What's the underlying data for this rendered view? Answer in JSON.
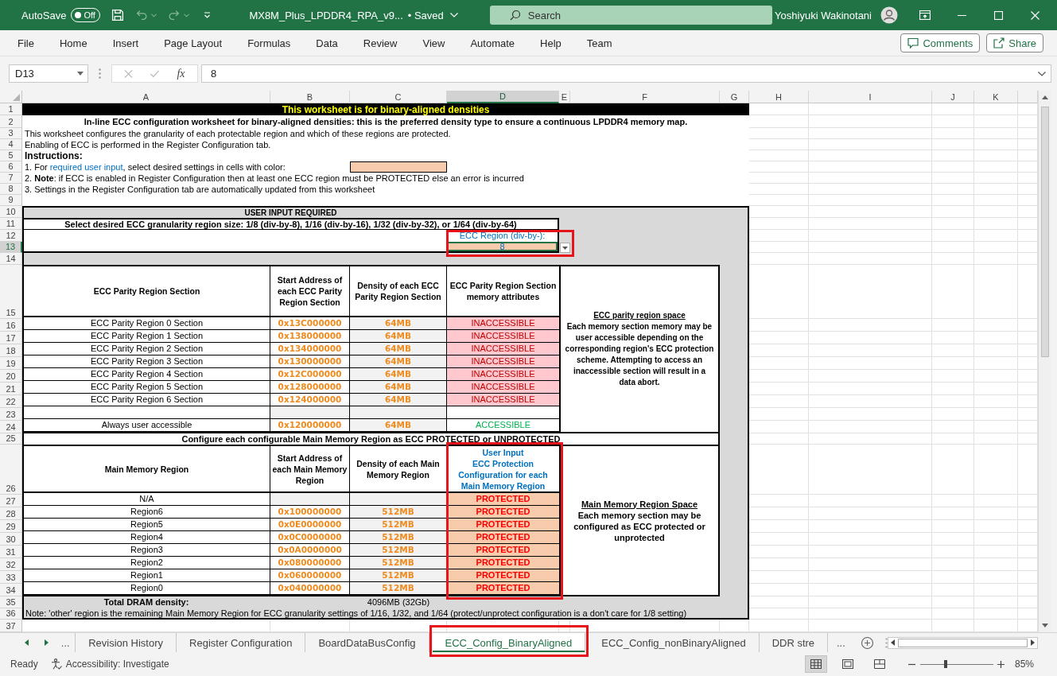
{
  "title_bar": {
    "autosave_label": "AutoSave",
    "autosave": {
      "on": false,
      "label": "Off"
    },
    "file_name": "MX8M_Plus_LPDDR4_RPA_v9...",
    "save_status": "• Saved",
    "search": {
      "placeholder": "Search"
    },
    "user_name": "Yoshiyuki Wakinotani"
  },
  "quick_access": [
    {
      "kind": "save",
      "disabled": false
    },
    {
      "kind": "undo",
      "disabled": true
    },
    {
      "kind": "redo",
      "disabled": true
    }
  ],
  "ribbon": {
    "tabs": [
      {
        "label": "File",
        "selected": false
      },
      {
        "label": "Home",
        "selected": false
      },
      {
        "label": "Insert",
        "selected": false
      },
      {
        "label": "Page Layout",
        "selected": false
      },
      {
        "label": "Formulas",
        "selected": false
      },
      {
        "label": "Data",
        "selected": false
      },
      {
        "label": "Review",
        "selected": false
      },
      {
        "label": "View",
        "selected": false
      },
      {
        "label": "Automate",
        "selected": false
      },
      {
        "label": "Help",
        "selected": false
      },
      {
        "label": "Team",
        "selected": false
      }
    ],
    "buttons": [
      {
        "kind": "comments",
        "label": "Comments"
      },
      {
        "kind": "share",
        "label": "Share"
      }
    ]
  },
  "formula_bar": {
    "name_box": "D13",
    "actions": [
      {
        "kind": "cancel",
        "disabled": true
      },
      {
        "kind": "enter",
        "disabled": true
      }
    ],
    "function_label": "fx",
    "value": "8"
  },
  "columns": [
    {
      "label": "A",
      "selected": false
    },
    {
      "label": "B",
      "selected": false
    },
    {
      "label": "C",
      "selected": false
    },
    {
      "label": "D",
      "selected": true
    },
    {
      "label": "E",
      "selected": false
    },
    {
      "label": "F",
      "selected": false
    },
    {
      "label": "G",
      "selected": false
    },
    {
      "label": "H",
      "selected": false
    },
    {
      "label": "I",
      "selected": false
    },
    {
      "label": "J",
      "selected": false
    },
    {
      "label": "K",
      "selected": false
    }
  ],
  "rows": [
    {
      "label": "1",
      "selected": false
    },
    {
      "label": "2",
      "selected": false
    },
    {
      "label": "3",
      "selected": false
    },
    {
      "label": "4",
      "selected": false
    },
    {
      "label": "5",
      "selected": false
    },
    {
      "label": "6",
      "selected": false
    },
    {
      "label": "7",
      "selected": false
    },
    {
      "label": "8",
      "selected": false
    },
    {
      "label": "9",
      "selected": false
    },
    {
      "label": "10",
      "selected": false
    },
    {
      "label": "11",
      "selected": false
    },
    {
      "label": "12",
      "selected": false
    },
    {
      "label": "13",
      "selected": true
    },
    {
      "label": "14",
      "selected": false
    },
    {
      "label": "15",
      "selected": false
    },
    {
      "label": "16",
      "selected": false
    },
    {
      "label": "17",
      "selected": false
    },
    {
      "label": "18",
      "selected": false
    },
    {
      "label": "19",
      "selected": false
    },
    {
      "label": "20",
      "selected": false
    },
    {
      "label": "21",
      "selected": false
    },
    {
      "label": "22",
      "selected": false
    },
    {
      "label": "23",
      "selected": false
    },
    {
      "label": "24",
      "selected": false
    },
    {
      "label": "25",
      "selected": false
    },
    {
      "label": "26",
      "selected": false
    },
    {
      "label": "27",
      "selected": false
    },
    {
      "label": "28",
      "selected": false
    },
    {
      "label": "29",
      "selected": false
    },
    {
      "label": "30",
      "selected": false
    },
    {
      "label": "31",
      "selected": false
    },
    {
      "label": "32",
      "selected": false
    },
    {
      "label": "33",
      "selected": false
    },
    {
      "label": "34",
      "selected": false
    },
    {
      "label": "35",
      "selected": false
    },
    {
      "label": "36",
      "selected": false
    },
    {
      "label": "37",
      "selected": false
    }
  ],
  "sheet": {
    "banner": "This worksheet is for binary-aligned densities",
    "heading": "In-line ECC configuration worksheet for binary-aligned densities: this is the preferred density type to ensure a continuous LPDDR4 memory map.",
    "intro": [
      "This worksheet configures the granularity of each protectable region and which of these regions are protected.",
      "Enabling of ECC is performed in the Register Configuration tab."
    ],
    "instructions_label": "Instructions:",
    "instructions": [
      {
        "parts": [
          {
            "kind": "plain",
            "text": "1. For "
          },
          {
            "kind": "input",
            "text": "required user input"
          },
          {
            "kind": "plain",
            "text": ", select desired settings in cells with color:"
          }
        ],
        "swatch": true
      },
      {
        "parts": [
          {
            "kind": "plain",
            "text": "2. **Note**: if ECC is enabled in Register Configuration then at least one ECC region must be PROTECTED else an error is incurred"
          }
        ],
        "swatch": false
      },
      {
        "parts": [
          {
            "kind": "plain",
            "text": "3. Settings in the Register Configuration tab are automatically updated from this worksheet"
          }
        ],
        "swatch": false
      }
    ],
    "user_input_title": "USER INPUT REQUIRED",
    "granularity_prompt": "Select desired ECC granularity region size: 1/8 (div-by-8), 1/16 (div-by-16), 1/32 (div-by-32), or 1/64 (div-by-64)",
    "ecc_region": {
      "label": "ECC Region (div-by-):",
      "value": "8",
      "selected": true,
      "highlighted": true
    },
    "parity_table": {
      "columns": [
        {
          "label": "ECC Parity Region Section",
          "user_input": false
        },
        {
          "label": "Start Address of each ECC Parity Region Section",
          "user_input": false
        },
        {
          "label": "Density of each ECC Parity Region Section",
          "user_input": false
        },
        {
          "label": "ECC Parity Region Section memory attributes",
          "user_input": false
        }
      ],
      "rows": [
        {
          "kind": "region",
          "name": "ECC Parity Region 0 Section",
          "address": "0x13C000000",
          "density": "64MB",
          "attribute": "INACCESSIBLE",
          "accessible": false
        },
        {
          "kind": "region",
          "name": "ECC Parity Region 1 Section",
          "address": "0x138000000",
          "density": "64MB",
          "attribute": "INACCESSIBLE",
          "accessible": false
        },
        {
          "kind": "region",
          "name": "ECC Parity Region 2 Section",
          "address": "0x134000000",
          "density": "64MB",
          "attribute": "INACCESSIBLE",
          "accessible": false
        },
        {
          "kind": "region",
          "name": "ECC Parity Region 3 Section",
          "address": "0x130000000",
          "density": "64MB",
          "attribute": "INACCESSIBLE",
          "accessible": false
        },
        {
          "kind": "region",
          "name": "ECC Parity Region 4 Section",
          "address": "0x12C000000",
          "density": "64MB",
          "attribute": "INACCESSIBLE",
          "accessible": false
        },
        {
          "kind": "region",
          "name": "ECC Parity Region 5 Section",
          "address": "0x128000000",
          "density": "64MB",
          "attribute": "INACCESSIBLE",
          "accessible": false
        },
        {
          "kind": "region",
          "name": "ECC Parity Region 6 Section",
          "address": "0x124000000",
          "density": "64MB",
          "attribute": "INACCESSIBLE",
          "accessible": false
        },
        {
          "kind": "blank"
        },
        {
          "kind": "region",
          "name": "Always user accessible",
          "address": "0x120000000",
          "density": "64MB",
          "attribute": "ACCESSIBLE",
          "accessible": true
        }
      ],
      "note": {
        "title": "ECC parity region space",
        "body": "Each memory section memory may be user accessible depending on the corresponding region's ECC protection scheme. Attempting to access an inaccessible section will result in a data abort."
      }
    },
    "main_section_title": "Configure each configurable Main Memory Region as ECC PROTECTED or UNPROTECTED",
    "main_table": {
      "highlighted": true,
      "columns": [
        {
          "label": "Main Memory Region",
          "user_input": false
        },
        {
          "label": "Start Address of each Main Memory Region",
          "user_input": false
        },
        {
          "label": "Density of each Main Memory Region",
          "user_input": false
        },
        {
          "label": "User Input\nECC Protection\nConfiguration for each\nMain Memory Region",
          "user_input": true
        }
      ],
      "rows": [
        {
          "name": "N/A",
          "protection": "PROTECTED",
          "protected": true
        },
        {
          "name": "Region6",
          "address": "0x100000000",
          "density": "512MB",
          "protection": "PROTECTED",
          "protected": true
        },
        {
          "name": "Region5",
          "address": "0x0E0000000",
          "density": "512MB",
          "protection": "PROTECTED",
          "protected": true
        },
        {
          "name": "Region4",
          "address": "0x0C0000000",
          "density": "512MB",
          "protection": "PROTECTED",
          "protected": true
        },
        {
          "name": "Region3",
          "address": "0x0A0000000",
          "density": "512MB",
          "protection": "PROTECTED",
          "protected": true
        },
        {
          "name": "Region2",
          "address": "0x080000000",
          "density": "512MB",
          "protection": "PROTECTED",
          "protected": true
        },
        {
          "name": "Region1",
          "address": "0x060000000",
          "density": "512MB",
          "protection": "PROTECTED",
          "protected": true
        },
        {
          "name": "Region0",
          "address": "0x040000000",
          "density": "512MB",
          "protection": "PROTECTED",
          "protected": true
        }
      ],
      "note": {
        "title": "Main Memory Region Space",
        "body": "Each memory section may be configured as ECC protected or unprotected"
      }
    },
    "total": {
      "label": "Total DRAM density:",
      "value": "4096MB (32Gb)"
    },
    "footnote": "Note: 'other' region is the remaining Main Memory Region for ECC granularity settings of 1/16, 1/32, and 1/64 (protect/unprotect configuration is a don't care for 1/8 setting)"
  },
  "sheet_tabs": {
    "more_left": "...",
    "tabs": [
      {
        "label": "Revision History",
        "selected": false,
        "highlighted": false
      },
      {
        "label": "Register Configuration",
        "selected": false,
        "highlighted": false
      },
      {
        "label": "BoardDataBusConfig",
        "selected": false,
        "highlighted": false
      },
      {
        "label": "ECC_Config_BinaryAligned",
        "selected": true,
        "highlighted": true
      },
      {
        "label": "ECC_Config_nonBinaryAligned",
        "selected": false,
        "highlighted": false
      },
      {
        "label": "DDR stre",
        "selected": false,
        "highlighted": false
      }
    ],
    "more_right": "..."
  },
  "status_bar": {
    "status": "Ready",
    "accessibility": "Accessibility: Investigate",
    "views": [
      {
        "kind": "normal",
        "selected": true
      },
      {
        "kind": "page-layout",
        "selected": false
      },
      {
        "kind": "page-break",
        "selected": false
      }
    ],
    "zoom": {
      "level": 0.35,
      "reading": "85%"
    }
  }
}
